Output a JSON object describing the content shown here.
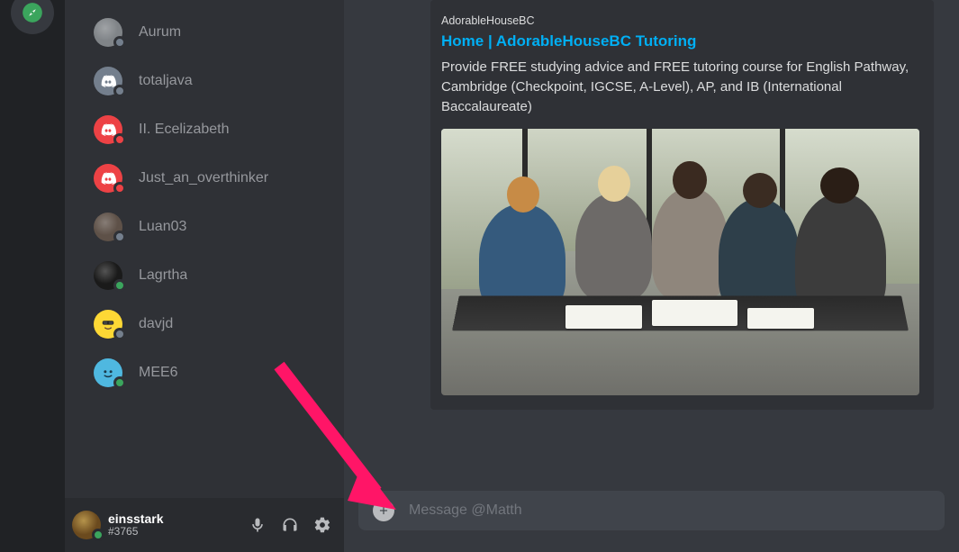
{
  "server_rail": {
    "active_server_icon": "explore-compass-icon"
  },
  "members": [
    {
      "name": "Aurum",
      "status": "offline",
      "avatar_bg": "#808488",
      "avatar_kind": "image"
    },
    {
      "name": "totaljava",
      "status": "offline",
      "avatar_bg": "#747f8d",
      "avatar_kind": "discord"
    },
    {
      "name": "II. Ecelizabeth",
      "status": "dnd",
      "avatar_bg": "#ed4245",
      "avatar_kind": "discord"
    },
    {
      "name": "Just_an_overthinker",
      "status": "dnd",
      "avatar_bg": "#ed4245",
      "avatar_kind": "discord"
    },
    {
      "name": "Luan03",
      "status": "offline",
      "avatar_bg": "#5e5148",
      "avatar_kind": "image"
    },
    {
      "name": "Lagrtha",
      "status": "online",
      "avatar_bg": "#1a1a1a",
      "avatar_kind": "image"
    },
    {
      "name": "davjd",
      "status": "offline",
      "avatar_bg": "#fdd835",
      "avatar_kind": "emoji"
    },
    {
      "name": "MEE6",
      "status": "online",
      "avatar_bg": "#4fb8e0",
      "avatar_kind": "mee6"
    }
  ],
  "user_panel": {
    "username": "einsstark",
    "discriminator": "#3765",
    "status": "online",
    "avatar_bg": "#6b4a1e"
  },
  "embed": {
    "provider": "AdorableHouseBC",
    "title": "Home | AdorableHouseBC Tutoring",
    "description": "Provide FREE studying advice and FREE tutoring course for English Pathway, Cambridge (Checkpoint, IGCSE, A-Level), AP, and IB (International Baccalaureate)"
  },
  "composer": {
    "placeholder": "Message @Matth"
  },
  "arrow_color": "#ff1567"
}
